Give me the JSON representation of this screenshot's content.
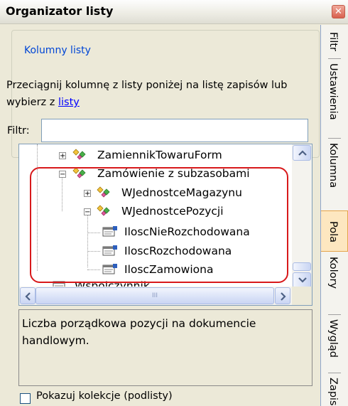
{
  "window": {
    "title": "Organizator listy",
    "close_label": "✕"
  },
  "group": {
    "legend": "Kolumny listy",
    "instruction": "Przeciągnij kolumnę z listy poniżej na listę zapisów lub wybierz z ",
    "link_label": "listy"
  },
  "filter": {
    "label": "Filtr:",
    "value": "",
    "placeholder": ""
  },
  "tree": {
    "items": [
      {
        "label": "ZamiennikTowaruForm",
        "expander": "+"
      },
      {
        "label": "Zamówienie z subzasobami",
        "expander": "−"
      },
      {
        "label": "WJednostceMagazynu",
        "expander": "+"
      },
      {
        "label": "WJednostcePozycji",
        "expander": "−"
      },
      {
        "label": "IloscNieRozchodowana",
        "expander": ""
      },
      {
        "label": "IloscRozchodowana",
        "expander": ""
      },
      {
        "label": "IloscZamowiona",
        "expander": ""
      },
      {
        "label": "Wspolczynnik",
        "expander": ""
      }
    ],
    "hscroll_thumb_grip": "III"
  },
  "description": "Liczba porządkowa pozycji na dokumencie handlowym.",
  "collections_checkbox": {
    "label": "Pokazuj kolekcje (podlisty)",
    "checked": false
  },
  "tabs": [
    {
      "label": "Filtr",
      "active": false
    },
    {
      "label": "Ustawienia",
      "active": false
    },
    {
      "label": "Kolumna",
      "active": false
    },
    {
      "label": "Pola",
      "active": true
    },
    {
      "label": "Kolory",
      "active": false
    },
    {
      "label": "Wygląd",
      "active": false
    },
    {
      "label": "Zapis",
      "active": false
    }
  ],
  "colors": {
    "highlight": "#d8191b",
    "link": "#0000ff",
    "active_tab": "#fde7c0"
  }
}
